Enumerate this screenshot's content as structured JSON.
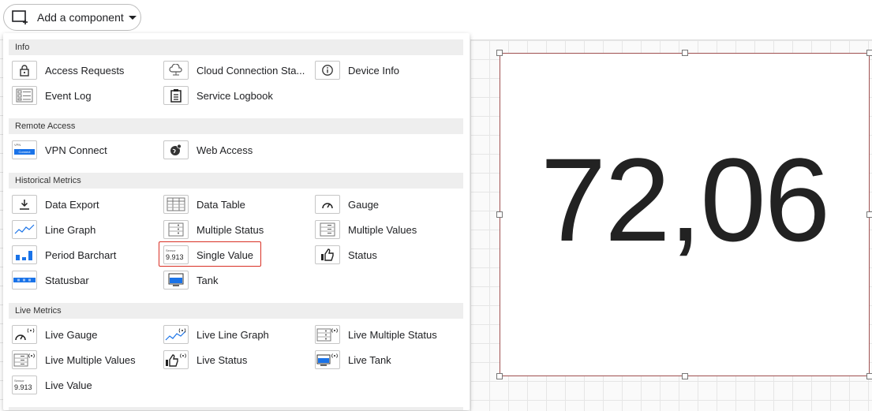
{
  "toolbar": {
    "add_component_label": "Add a component"
  },
  "sections": {
    "info": {
      "title": "Info",
      "items": [
        "Access Requests",
        "Cloud Connection Sta...",
        "Device Info",
        "Event Log",
        "Service Logbook"
      ]
    },
    "remote": {
      "title": "Remote Access",
      "items": [
        "VPN Connect",
        "Web Access"
      ]
    },
    "historical": {
      "title": "Historical Metrics",
      "items": [
        "Data Export",
        "Data Table",
        "Gauge",
        "Line Graph",
        "Multiple Status",
        "Multiple Values",
        "Period Barchart",
        "Single Value",
        "Status",
        "Statusbar",
        "Tank"
      ]
    },
    "live": {
      "title": "Live Metrics",
      "items": [
        "Live Gauge",
        "Live Line Graph",
        "Live Multiple Status",
        "Live Multiple Values",
        "Live Status",
        "Live Tank",
        "Live Value"
      ]
    }
  },
  "widget": {
    "value": "72,06"
  },
  "icons": {
    "vpn_small_text": "VPN",
    "vpn_button_text": "Connect",
    "single_value_small": "Sensor",
    "single_value_number": "9.913",
    "live_value_small": "Sensor",
    "live_value_number": "9.913"
  },
  "colors": {
    "accent_blue": "#1a73e8",
    "highlight_red": "#d93025",
    "widget_border": "#a05050"
  }
}
